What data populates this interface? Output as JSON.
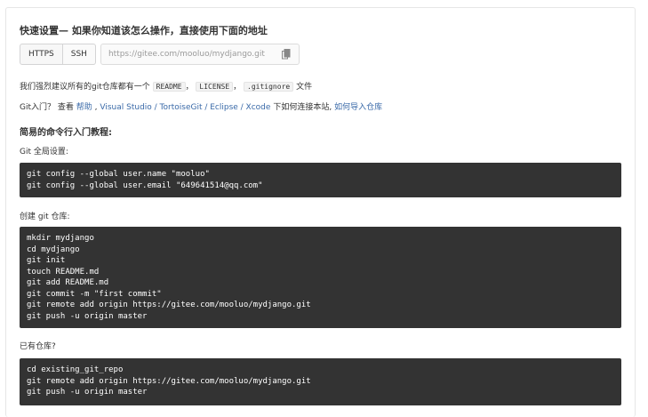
{
  "quick_setup": {
    "title": "快速设置— 如果你知道该怎么操作，直接使用下面的地址",
    "protocols": [
      "HTTPS",
      "SSH"
    ],
    "repo_url": "https://gitee.com/mooluo/mydjango.git"
  },
  "recommend": {
    "prefix": "我们强烈建议所有的git仓库都有一个",
    "files": [
      "README",
      "LICENSE",
      ".gitignore"
    ],
    "sep": "，",
    "suffix": "文件"
  },
  "help_line": {
    "prefix": "Git入门？ 查看",
    "help_link": "帮助",
    "clients": "Visual Studio / TortoiseGit / Eclipse / Xcode",
    "middle": "下如何连接本站,",
    "import_link": "如何导入仓库"
  },
  "tutorial": {
    "heading": "简易的命令行入门教程:",
    "sections": [
      {
        "label": "Git 全局设置:",
        "code": [
          "git config --global user.name \"mooluo\"",
          "git config --global user.email \"649641514@qq.com\""
        ]
      },
      {
        "label": "创建 git 仓库:",
        "code": [
          "mkdir mydjango",
          "cd mydjango",
          "git init",
          "touch README.md",
          "git add README.md",
          "git commit -m \"first commit\"",
          "git remote add origin https://gitee.com/mooluo/mydjango.git",
          "git push -u origin master"
        ]
      },
      {
        "label": "已有仓库?",
        "code": [
          "cd existing_git_repo",
          "git remote add origin https://gitee.com/mooluo/mydjango.git",
          "git push -u origin master"
        ]
      }
    ]
  },
  "colors": {
    "code_bg": "#333333",
    "link": "#3a6aa8",
    "panel_border": "#e6e6e6"
  },
  "icons": {
    "copy": "copy-icon"
  }
}
